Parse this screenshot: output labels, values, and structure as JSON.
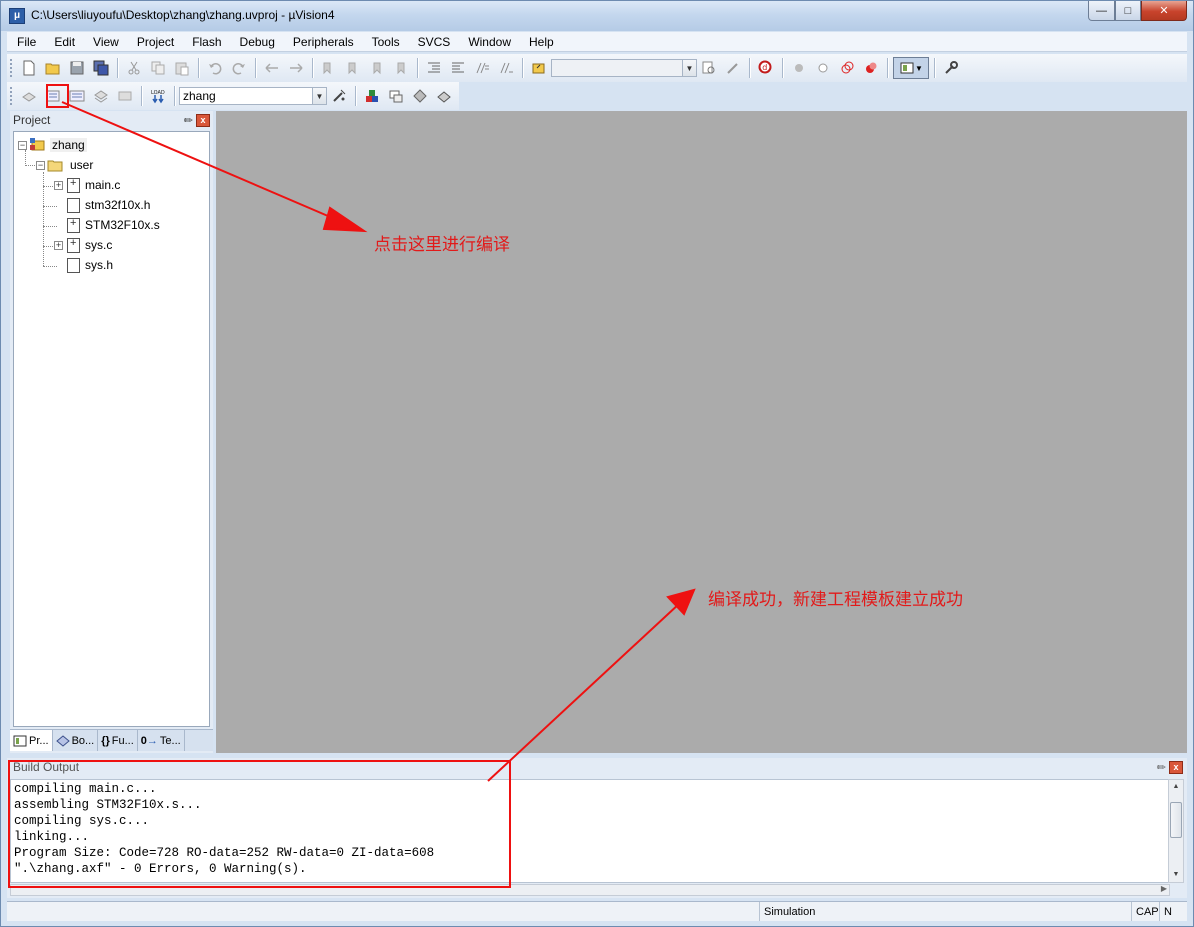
{
  "window": {
    "title": "C:\\Users\\liuyoufu\\Desktop\\zhang\\zhang.uvproj - µVision4",
    "app_icon": "uvision-icon"
  },
  "menu": [
    "File",
    "Edit",
    "View",
    "Project",
    "Flash",
    "Debug",
    "Peripherals",
    "Tools",
    "SVCS",
    "Window",
    "Help"
  ],
  "toolbar2": {
    "target_value": "zhang"
  },
  "project_pane": {
    "title": "Project",
    "root": "zhang",
    "group": "user",
    "files": [
      "main.c",
      "stm32f10x.h",
      "STM32F10x.s",
      "sys.c",
      "sys.h"
    ],
    "tabs": [
      "Pr...",
      "Bo...",
      "Fu...",
      "Te..."
    ]
  },
  "build_output": {
    "title": "Build Output",
    "lines": [
      "compiling main.c...",
      "assembling STM32F10x.s...",
      "compiling sys.c...",
      "linking...",
      "Program Size: Code=728 RO-data=252 RW-data=0 ZI-data=608",
      "\".\\zhang.axf\" - 0 Errors, 0 Warning(s)."
    ]
  },
  "status": {
    "mode": "Simulation",
    "caps": "CAP",
    "num": "N"
  },
  "annotations": {
    "compile_hint": "点击这里进行编译",
    "success_note": "编译成功，新建工程模板建立成功",
    "color": "#ee1111"
  }
}
